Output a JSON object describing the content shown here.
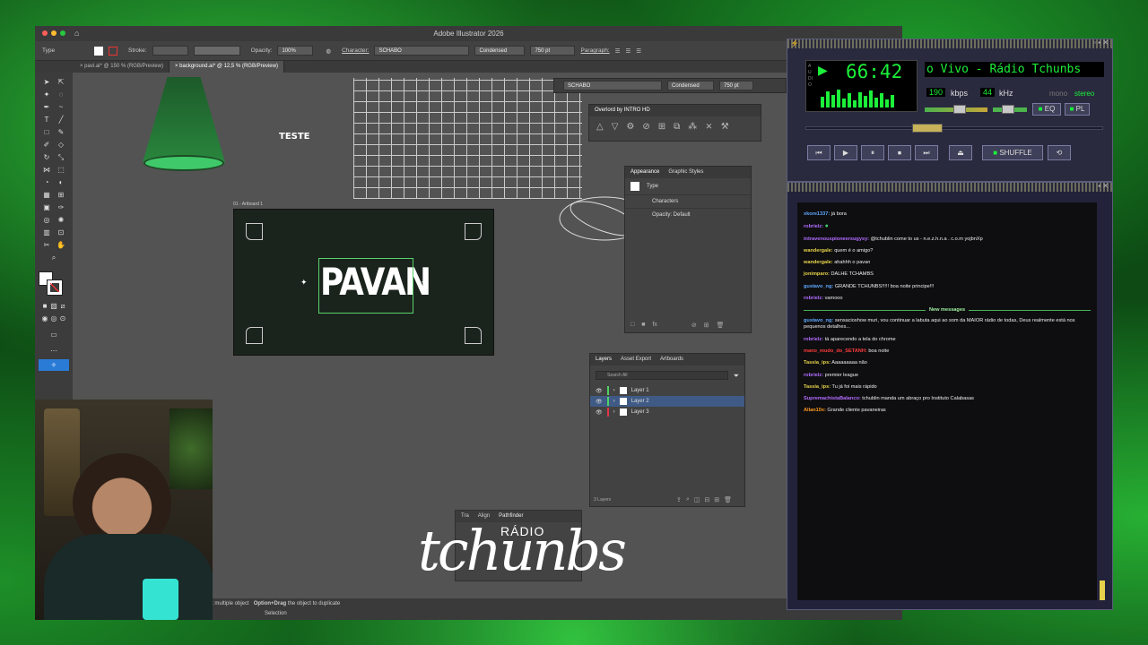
{
  "illustrator": {
    "title": "Adobe Illustrator 2026",
    "control_bar": {
      "type_label": "Type",
      "stroke_label": "Stroke:",
      "opacity_label": "Opacity:",
      "opacity_value": "100%",
      "character_label": "Character:",
      "font": "SCHABO",
      "style": "Condensed",
      "size": "750 pt",
      "paragraph_label": "Paragraph:"
    },
    "tabs": [
      {
        "label": "pavi.ai* @ 150 % (RGB/Preview)"
      },
      {
        "label": "background.ai* @ 12,5 % (RGB/Preview)"
      }
    ],
    "canvas": {
      "teste_text": "TESTE",
      "artboard_label": "01 - Artboard 1",
      "pavan_text": "PAVAN"
    },
    "type_options": {
      "font": "SCHABO",
      "style": "Condensed",
      "size": "750 pt"
    },
    "overlord_panel": {
      "title": "Overlord by INTRO HD"
    },
    "appearance_panel": {
      "tabs": [
        "Appearance",
        "Graphic Styles"
      ],
      "item_type": "Type",
      "characters": "Characters",
      "opacity": "Opacity: Default"
    },
    "layers_panel": {
      "tabs": [
        "Layers",
        "Asset Export",
        "Artboards"
      ],
      "search_placeholder": "Search All",
      "layers": [
        {
          "name": "Layer 1",
          "color": "#4fd163"
        },
        {
          "name": "Layer 2",
          "color": "#4fd163"
        },
        {
          "name": "Layer 3",
          "color": "#e2334b"
        }
      ],
      "count": "3 Layers"
    },
    "pathfinder_panel": {
      "tabs": [
        "Tra",
        "Align",
        "Pathfinder"
      ]
    },
    "status": {
      "hint_prefix": "t multiple object",
      "hint_key": "Option+Drag",
      "hint_suffix": "the object to duplicate",
      "mode": "Selection"
    }
  },
  "logo": {
    "top": "RÁDIO",
    "main": "tchunbs"
  },
  "winamp": {
    "lcd_side": "AUDIO",
    "time": "66:42",
    "marquee": "o Vivo - Rádio Tchunbs",
    "kbps_value": "190",
    "kbps_label": "kbps",
    "khz_value": "44",
    "khz_label": "kHz",
    "mono": "mono",
    "stereo": "stereo",
    "eq_label": "EQ",
    "pl_label": "PL",
    "shuffle_label": "SHUFFLE"
  },
  "chat": {
    "messages": [
      {
        "user": "xkore1337:",
        "text": " já bora",
        "color": "#5fa8ff"
      },
      {
        "user": "robrielz:",
        "text": " ",
        "color": "#b36cff"
      },
      {
        "user": "intravenouspioneersugysy:",
        "text": " @tchublin come to us - n.e.z.h.n.a . c.o.m yojbnXp",
        "color": "#b36cff"
      },
      {
        "user": "wandergale:",
        "text": " quem é o amigo?",
        "color": "#e6d24a"
      },
      {
        "user": "wandergale:",
        "text": " ahahhh o pavan",
        "color": "#e6d24a"
      },
      {
        "user": "jonimparo:",
        "text": " DALHE TCHAMBS",
        "color": "#e6d24a"
      },
      {
        "user": "gustavo_ng:",
        "text": " GRANDE TCHUNBS!!!!! boa noite principe!!!",
        "color": "#5fa8ff"
      },
      {
        "user": "robrielz:",
        "text": " vamooo",
        "color": "#b36cff"
      }
    ],
    "new_messages_label": "New messages",
    "new_list": [
      {
        "user": "gustavo_ng:",
        "text": " sensacioshow muri, vou continuar a labuta aqui ao som da MAIOR rádio de todas, Deus realmente está nos pequenos detalhes...",
        "color": "#5fa8ff"
      },
      {
        "user": "robrielz:",
        "text": " tá aparecendo a tela do chrome",
        "color": "#b36cff"
      },
      {
        "user": "mano_mudo_do_SETANH:",
        "text": " boa noite",
        "color": "#ff3b3b"
      },
      {
        "user": "Tassia_ips:",
        "text": " Aaaaaaaaa não",
        "color": "#e6d24a"
      },
      {
        "user": "robrielz:",
        "text": " premier league",
        "color": "#b36cff"
      },
      {
        "user": "Tassia_ips:",
        "text": " Tu já foi mais rápido",
        "color": "#e6d24a"
      },
      {
        "user": "SupremachistaBalanco:",
        "text": " tchublin manda um abraço pro Instituto Calabasas",
        "color": "#b36cff"
      },
      {
        "user": "Allan10x:",
        "text": " Grande cliente pavaneiras",
        "color": "#ff9a1f"
      }
    ]
  }
}
